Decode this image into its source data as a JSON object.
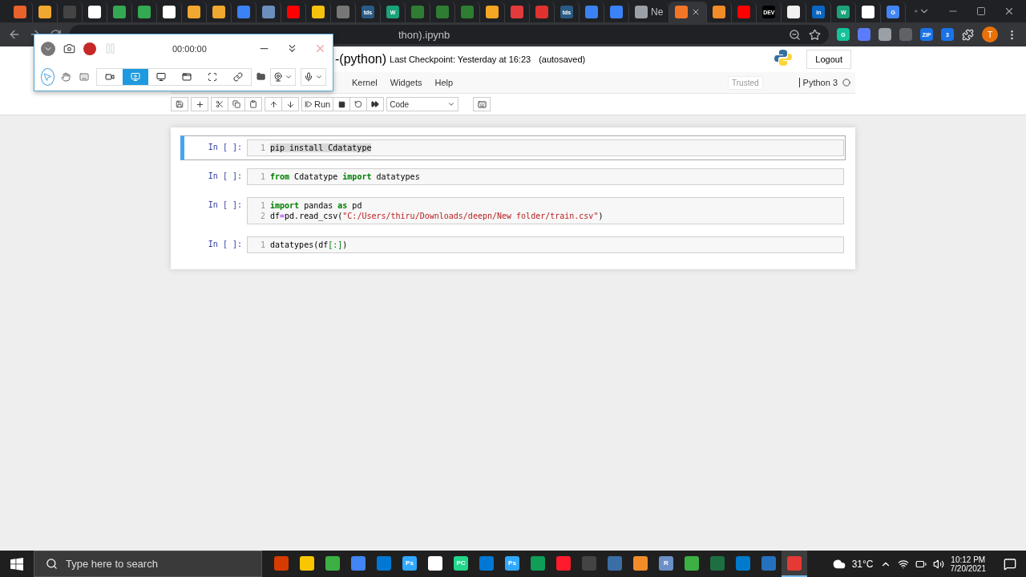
{
  "browser": {
    "tabs": [
      {
        "color": "#e8622c",
        "selected": false
      },
      {
        "color": "#f0a830",
        "selected": false
      },
      {
        "color": "#444444",
        "selected": false
      },
      {
        "color": "#ffffff",
        "selected": false
      },
      {
        "color": "#34a853",
        "selected": false
      },
      {
        "color": "#34a853",
        "selected": false
      },
      {
        "color": "#ffffff",
        "selected": false
      },
      {
        "color": "#f0a830",
        "selected": false
      },
      {
        "color": "#f0a830",
        "selected": false
      },
      {
        "color": "#3b82f6",
        "selected": false
      },
      {
        "color": "#6c8ebf",
        "selected": false
      },
      {
        "color": "#ff0000",
        "selected": false
      },
      {
        "color": "#f4c20d",
        "selected": false
      },
      {
        "color": "#777777",
        "selected": false
      },
      {
        "color": "#2b5b84",
        "glyph": "tds",
        "selected": false
      },
      {
        "color": "#1ba27a",
        "glyph": "W",
        "selected": false
      },
      {
        "color": "#2e7d32",
        "selected": false
      },
      {
        "color": "#2e7d32",
        "selected": false
      },
      {
        "color": "#2e7d32",
        "selected": false
      },
      {
        "color": "#f5a623",
        "selected": false
      },
      {
        "color": "#e33b3b",
        "selected": false
      },
      {
        "color": "#e0322e",
        "selected": false
      },
      {
        "color": "#2b5b84",
        "glyph": "tds",
        "selected": false
      },
      {
        "color": "#3b82f6",
        "selected": false
      },
      {
        "color": "#3b82f6",
        "selected": false
      },
      {
        "color": "#9aa0a6",
        "label": "Ne",
        "selected": false
      },
      {
        "color": "#f37626",
        "selected": true
      },
      {
        "color": "#f28c28",
        "selected": false
      },
      {
        "color": "#ff0000",
        "selected": false
      },
      {
        "color": "#000000",
        "glyph": "DEV",
        "selected": false
      },
      {
        "color": "#f1f1f1",
        "selected": false
      },
      {
        "color": "#0a66c2",
        "glyph": "in",
        "selected": false
      },
      {
        "color": "#1ba27a",
        "glyph": "W",
        "selected": false
      },
      {
        "color": "#ffffff",
        "selected": false
      },
      {
        "color": "#4285f4",
        "glyph": "G",
        "selected": false
      }
    ],
    "address": "thon).ipynb",
    "extensions": [
      {
        "color": "#15c39a",
        "glyph": "G"
      },
      {
        "color": "#5b7cfa"
      },
      {
        "color": "#9aa0a6"
      },
      {
        "color": "#5f6368"
      },
      {
        "color": "#1a73e8",
        "glyph": "ZIP"
      },
      {
        "color": "#1a73e8",
        "glyph": "3"
      }
    ],
    "profile": "T"
  },
  "recorder": {
    "time": "00:00:00",
    "recording": true,
    "tools": [
      {
        "kind": "cursor",
        "selected": true
      },
      {
        "kind": "hand",
        "selected": false
      },
      {
        "kind": "keyboard",
        "selected": false
      }
    ],
    "modes": [
      {
        "kind": "video",
        "selected": false
      },
      {
        "kind": "screen",
        "selected": true
      },
      {
        "kind": "monitor",
        "selected": false
      },
      {
        "kind": "window",
        "selected": false
      },
      {
        "kind": "fullscreen",
        "selected": false
      },
      {
        "kind": "link",
        "selected": false
      }
    ]
  },
  "notebook": {
    "title": "-(python)",
    "checkpoint": "Last Checkpoint: Yesterday at 16:23",
    "autosave": "(autosaved)",
    "logout": "Logout",
    "menu": [
      "Kernel",
      "Widgets",
      "Help"
    ],
    "trusted": "Trusted",
    "kernel": "Python 3",
    "run": "Run",
    "cell_type": "Code",
    "cells": [
      {
        "prompt": "In [ ]:",
        "selected": true,
        "lines": [
          {
            "number": "1",
            "tokens": [
              {
                "kind": "highlight",
                "text": "pip install Cdatatype"
              }
            ]
          }
        ]
      },
      {
        "prompt": "In [ ]:",
        "selected": false,
        "lines": [
          {
            "number": "1",
            "tokens": [
              {
                "kind": "keyword",
                "text": "from"
              },
              {
                "kind": "plain",
                "text": " Cdatatype "
              },
              {
                "kind": "keyword",
                "text": "import"
              },
              {
                "kind": "plain",
                "text": " datatypes"
              }
            ]
          }
        ]
      },
      {
        "prompt": "In [ ]:",
        "selected": false,
        "lines": [
          {
            "number": "1",
            "tokens": [
              {
                "kind": "keyword",
                "text": "import"
              },
              {
                "kind": "plain",
                "text": " pandas "
              },
              {
                "kind": "keyword",
                "text": "as"
              },
              {
                "kind": "plain",
                "text": " pd"
              }
            ]
          },
          {
            "number": "2",
            "tokens": [
              {
                "kind": "plain",
                "text": "df"
              },
              {
                "kind": "operator",
                "text": "="
              },
              {
                "kind": "plain",
                "text": "pd.read_csv("
              },
              {
                "kind": "string",
                "text": "\"C:/Users/thiru/Downloads/deepn/New folder/train.csv\""
              },
              {
                "kind": "plain",
                "text": ")"
              }
            ]
          }
        ]
      },
      {
        "prompt": "In [ ]:",
        "selected": false,
        "lines": [
          {
            "number": "1",
            "tokens": [
              {
                "kind": "plain",
                "text": "datatypes(df"
              },
              {
                "kind": "bracket",
                "text": "[:]"
              },
              {
                "kind": "plain",
                "text": ")"
              }
            ]
          }
        ]
      }
    ]
  },
  "taskbar": {
    "search": "Type here to search",
    "apps": [
      {
        "color": "#d83b01",
        "selected": false
      },
      {
        "color": "#f8c700",
        "selected": false
      },
      {
        "color": "#3cb043",
        "selected": false
      },
      {
        "color": "#4285f4",
        "selected": false
      },
      {
        "color": "#0078d4",
        "selected": false
      },
      {
        "color": "#31a8ff",
        "glyph": "Ps",
        "selected": false
      },
      {
        "color": "#ffffff",
        "selected": false
      },
      {
        "color": "#21d789",
        "glyph": "PC",
        "selected": false
      },
      {
        "color": "#0078d4",
        "selected": false
      },
      {
        "color": "#31a8ff",
        "glyph": "Ps",
        "selected": false
      },
      {
        "color": "#0f9d58",
        "selected": false
      },
      {
        "color": "#ff1b2d",
        "selected": false
      },
      {
        "color": "#444444",
        "selected": false
      },
      {
        "color": "#3a6ea5",
        "selected": false
      },
      {
        "color": "#f28c28",
        "selected": false
      },
      {
        "color": "#6b8fc7",
        "glyph": "R",
        "selected": false
      },
      {
        "color": "#3cb043",
        "selected": false
      },
      {
        "color": "#1d6f42",
        "selected": false
      },
      {
        "color": "#007acc",
        "selected": false
      },
      {
        "color": "#2671be",
        "selected": false
      },
      {
        "color": "#e53935",
        "selected": true
      }
    ],
    "temperature": "31°C",
    "time": "10:12 PM",
    "date": "7/20/2021"
  }
}
